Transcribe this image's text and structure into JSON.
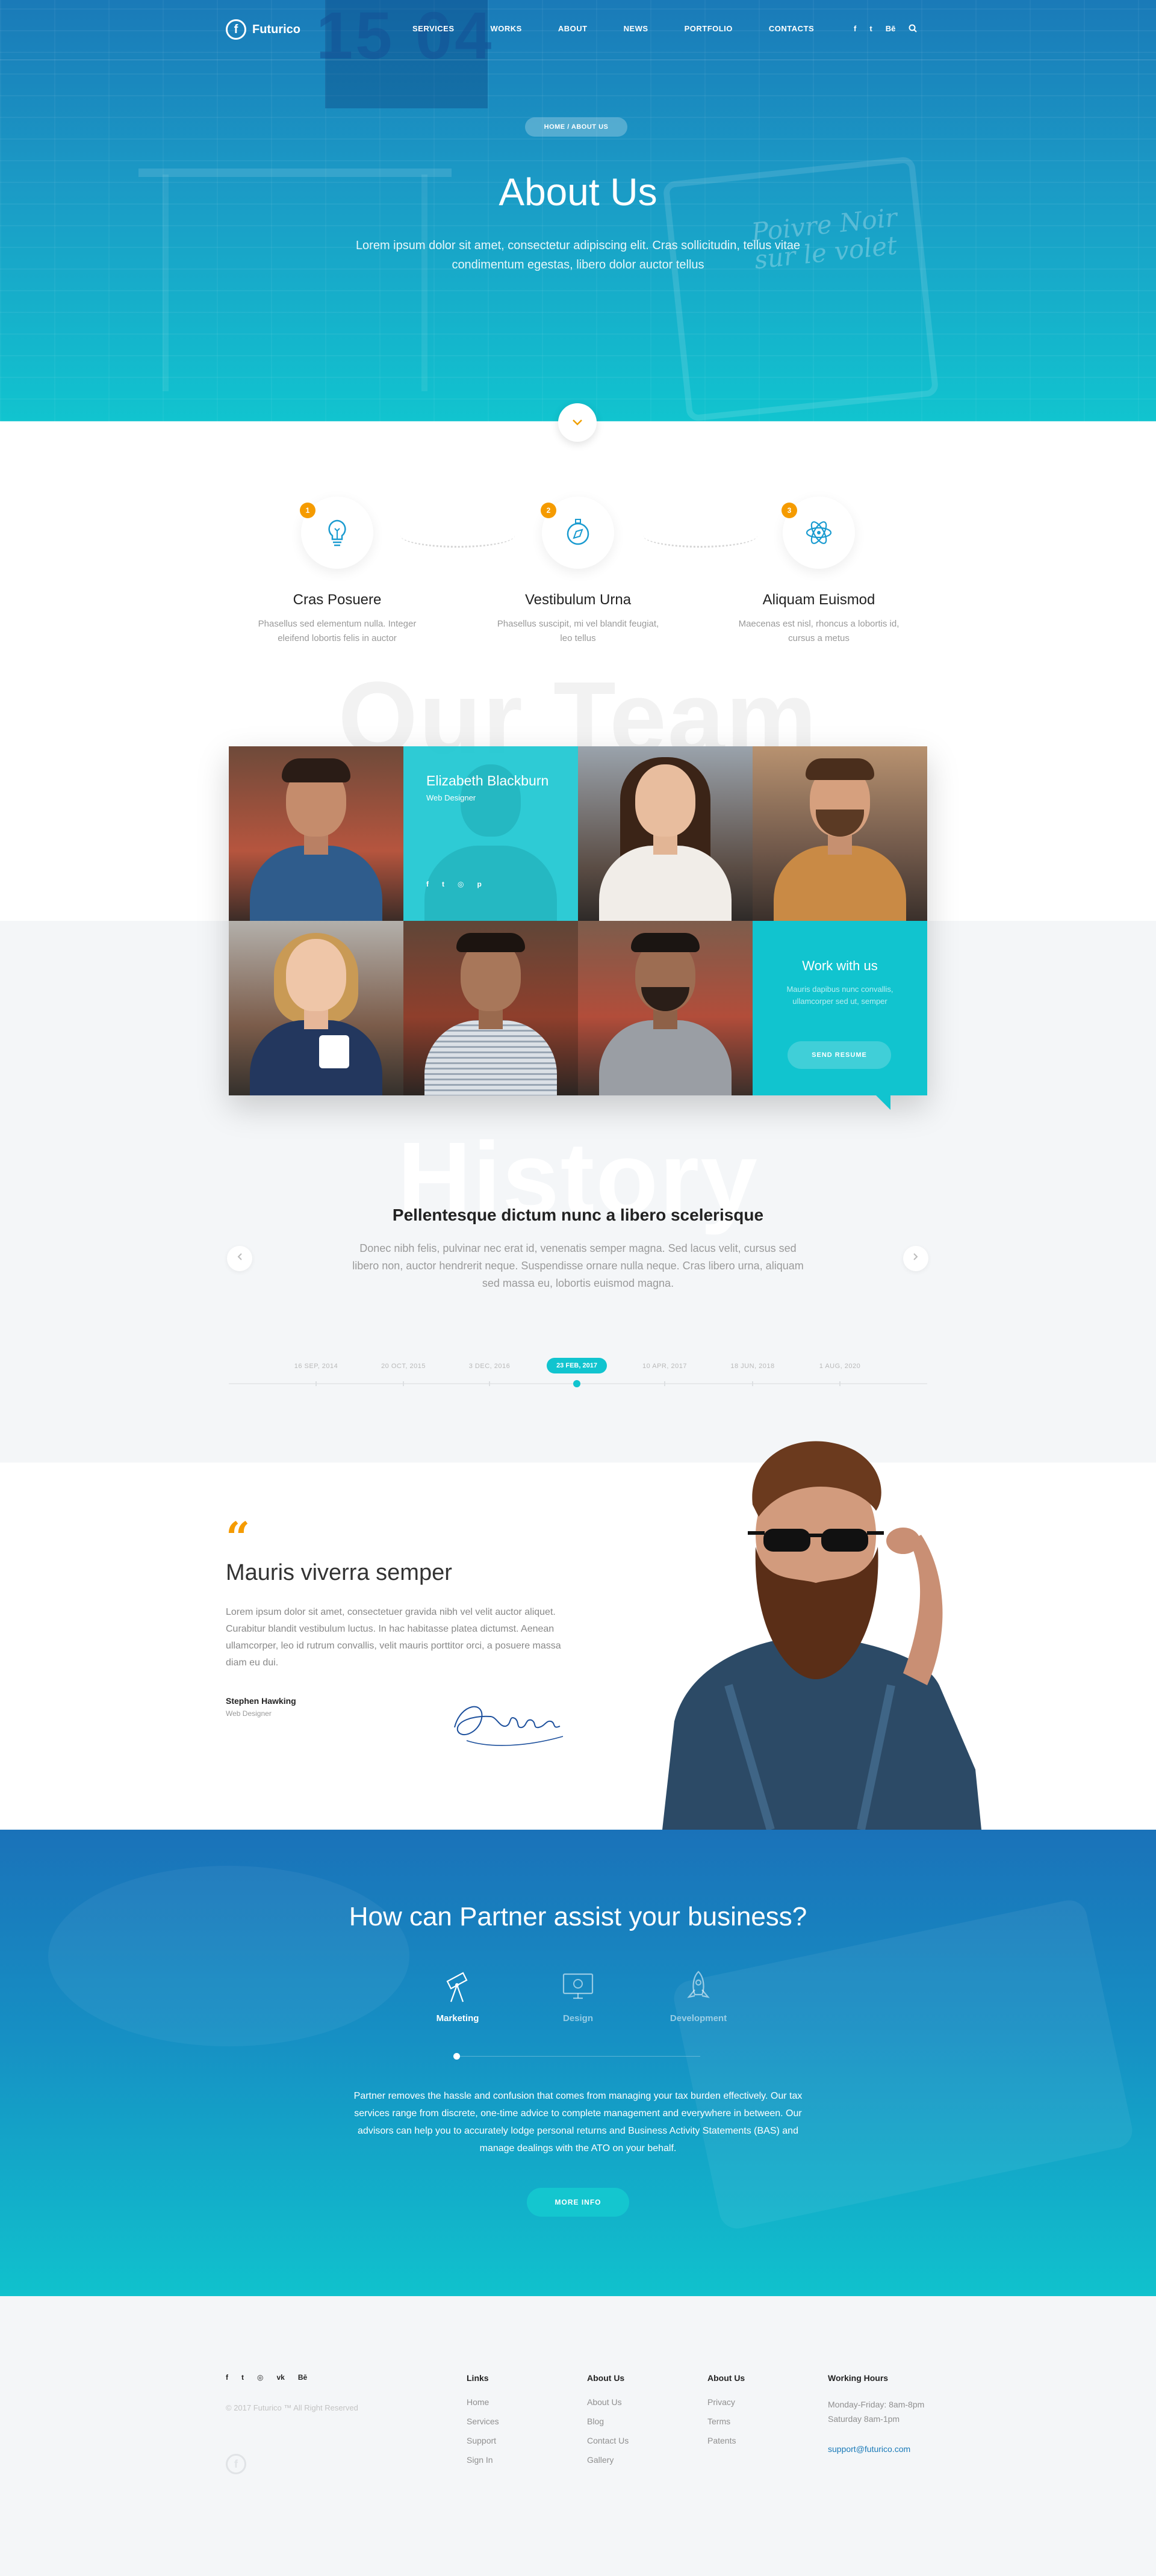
{
  "brand": {
    "name": "Futurico",
    "logo_letter": "f"
  },
  "nav": {
    "items": [
      "Services",
      "Works",
      "About",
      "News",
      "Portfolio",
      "Contacts"
    ],
    "social": [
      "f",
      "t",
      "Bē"
    ]
  },
  "hero": {
    "date": "15 04",
    "sign": "Poivre Noir sur le volet",
    "breadcrumb": "HOME / ABOUT US",
    "title": "About Us",
    "lead": "Lorem ipsum dolor sit amet, consectetur adipiscing elit. Cras sollicitudin, tellus vitae condimentum egestas, libero dolor auctor tellus"
  },
  "features": [
    {
      "num": "1",
      "icon": "lightbulb-icon",
      "title": "Cras Posuere",
      "text": "Phasellus sed elementum nulla. Integer eleifend lobortis felis in auctor"
    },
    {
      "num": "2",
      "icon": "compass-icon",
      "title": "Vestibulum Urna",
      "text": "Phasellus suscipit, mi vel blandit feugiat, leo tellus"
    },
    {
      "num": "3",
      "icon": "atom-icon",
      "title": "Aliquam Euismod",
      "text": "Maecenas est nisl, rhoncus a lobortis id, cursus a metus"
    }
  ],
  "team": {
    "title": "Our Team",
    "hover": {
      "name": "Elizabeth Blackburn",
      "role": "Web Designer",
      "social": [
        "f",
        "t",
        "◎",
        "p"
      ]
    },
    "cta": {
      "title": "Work with us",
      "text": "Mauris dapibus nunc convallis, ullamcorper sed ut, semper",
      "button": "SEND RESUME"
    }
  },
  "history": {
    "title": "History",
    "subtitle": "Pellentesque dictum nunc a libero scelerisque",
    "text": "Donec nibh felis, pulvinar nec erat id, venenatis semper magna. Sed lacus velit, cursus sed libero non, auctor hendrerit neque. Suspendisse ornare nulla neque. Cras libero urna, aliquam sed massa eu, lobortis euismod magna.",
    "timeline": [
      "16 SEP, 2014",
      "20 OCT, 2015",
      "3 DEC, 2016",
      "23 FEB, 2017",
      "10 APR, 2017",
      "18 JUN, 2018",
      "1 AUG, 2020"
    ],
    "active_index": 3
  },
  "testimonial": {
    "quote_mark": "“",
    "title": "Mauris viverra semper",
    "text": "Lorem ipsum dolor sit amet, consectetuer gravida nibh vel velit auctor aliquet. Curabitur blandit vestibulum luctus. In hac habitasse platea dictumst. Aenean ullamcorper, leo id rutrum convallis, velit mauris porttitor orci, a posuere massa diam eu dui.",
    "name": "Stephen Hawking",
    "role": "Web Designer"
  },
  "partner": {
    "title": "How can Partner assist your business?",
    "tabs": [
      {
        "label": "Marketing",
        "icon": "telescope-icon",
        "active": true
      },
      {
        "label": "Design",
        "icon": "monitor-icon",
        "active": false
      },
      {
        "label": "Development",
        "icon": "rocket-icon",
        "active": false
      }
    ],
    "text": "Partner removes the hassle and confusion that comes from managing your tax burden effectively. Our tax services range from discrete, one-time advice to complete management and everywhere in between. Our advisors can help you to accurately lodge personal returns and Business Activity Statements (BAS) and manage dealings with the ATO on your behalf.",
    "button": "MORE INFO"
  },
  "footer": {
    "social": [
      "f",
      "t",
      "◎",
      "vk",
      "Bē"
    ],
    "copyright": "© 2017 Futurico ™ All Right Reserved",
    "columns": [
      {
        "title": "Links",
        "items": [
          "Home",
          "Services",
          "Support",
          "Sign In"
        ]
      },
      {
        "title": "About Us",
        "items": [
          "About Us",
          "Blog",
          "Contact Us",
          "Gallery"
        ]
      },
      {
        "title": "About Us",
        "items": [
          "Privacy",
          "Terms",
          "Patents"
        ]
      }
    ],
    "hours": {
      "title": "Working Hours",
      "lines": [
        "Monday-Friday: 8am-8pm",
        "Saturday 8am-1pm"
      ],
      "email": "support@futurico.com"
    }
  },
  "colors": {
    "accent": "#11c4cf",
    "primary": "#1a7ab8",
    "orange": "#f59b00",
    "footer_bg": "#f4f6f8"
  }
}
